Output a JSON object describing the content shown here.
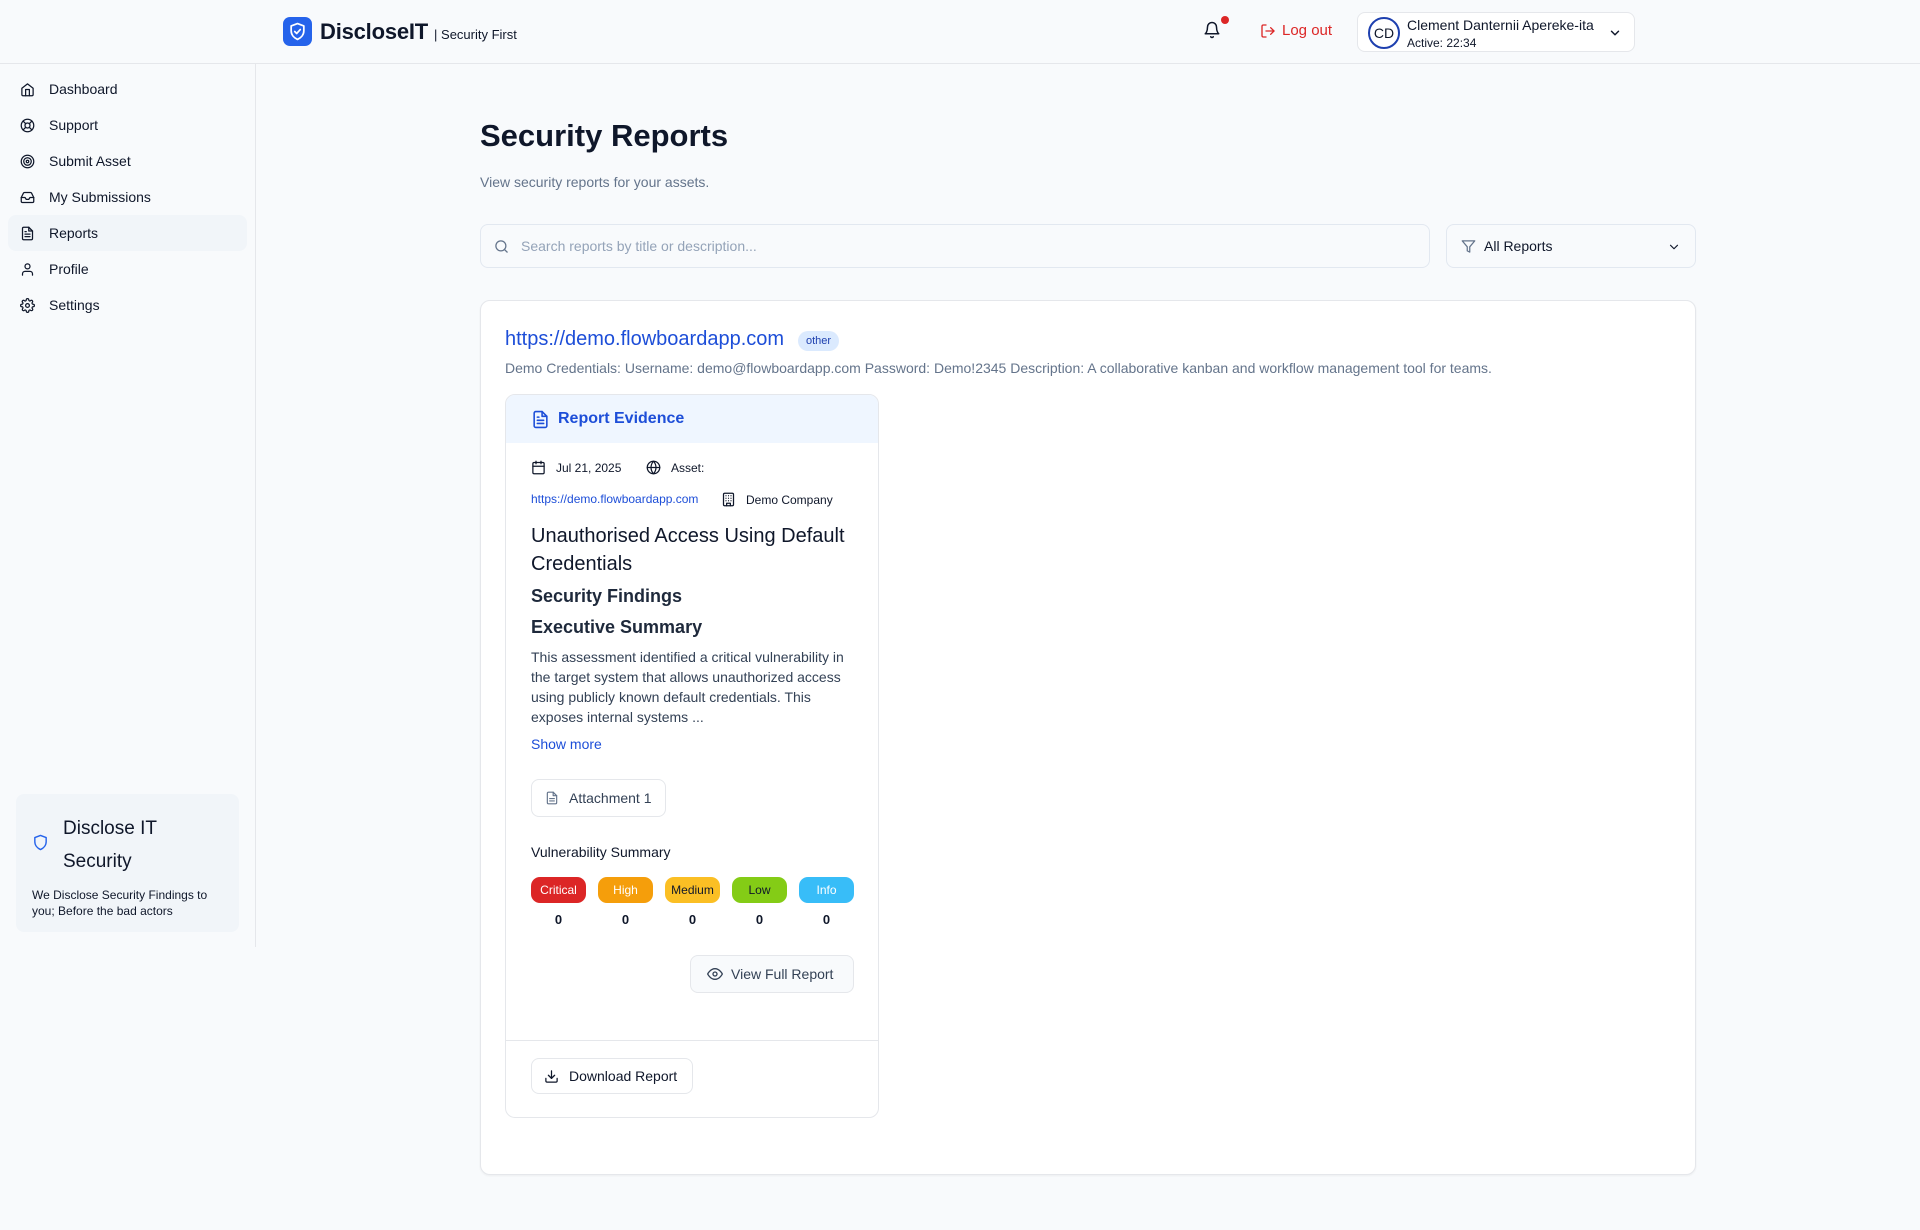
{
  "header": {
    "brand_name": "DiscloseIT",
    "brand_tagline": "| Security First",
    "logout_label": "Log out",
    "user": {
      "initials": "CD",
      "name": "Clement Danternii Apereke-ita",
      "active": "Active: 22:34"
    }
  },
  "sidebar": {
    "items": [
      {
        "label": "Dashboard",
        "icon": "home-icon"
      },
      {
        "label": "Support",
        "icon": "lifebuoy-icon"
      },
      {
        "label": "Submit Asset",
        "icon": "target-icon"
      },
      {
        "label": "My Submissions",
        "icon": "inbox-icon"
      },
      {
        "label": "Reports",
        "icon": "file-text-icon"
      },
      {
        "label": "Profile",
        "icon": "user-icon"
      },
      {
        "label": "Settings",
        "icon": "gear-icon"
      }
    ],
    "active_item": "Reports",
    "promo": {
      "title": "Disclose IT Security",
      "text": "We Disclose Security Findings to you; Before the bad actors"
    }
  },
  "main": {
    "title": "Security Reports",
    "subtitle": "View security reports for your assets.",
    "search_placeholder": "Search reports by title or description...",
    "filter_label": "All Reports",
    "asset": {
      "url": "https://demo.flowboardapp.com",
      "badge": "other",
      "description": "Demo Credentials: Username: demo@flowboardapp.com Password: Demo!2345 Description: A collaborative kanban and workflow management tool for teams.",
      "report": {
        "header": "Report Evidence",
        "date": "Jul 21, 2025",
        "asset_label": "Asset:",
        "asset_link": "https://demo.flowboardapp.com",
        "company": "Demo Company",
        "title": "Unauthorised Access Using Default Credentials",
        "findings_heading": "Security Findings",
        "summary_heading": "Executive Summary",
        "summary_text": "This assessment identified a critical vulnerability in the target system that allows unauthorized access using publicly known default credentials. This exposes internal systems ...",
        "show_more": "Show more",
        "attachment": "Attachment 1",
        "vuln_summary_label": "Vulnerability Summary",
        "severities": [
          {
            "label": "Critical",
            "count": "0",
            "color": "#dc2626",
            "text_color": "#ffffff"
          },
          {
            "label": "High",
            "count": "0",
            "color": "#f59e0b",
            "text_color": "#ffffff"
          },
          {
            "label": "Medium",
            "count": "0",
            "color": "#fbbf24",
            "text_color": "#0f172a"
          },
          {
            "label": "Low",
            "count": "0",
            "color": "#84cc16",
            "text_color": "#0f172a"
          },
          {
            "label": "Info",
            "count": "0",
            "color": "#38bdf8",
            "text_color": "#ffffff"
          }
        ],
        "view_full_label": "View Full Report",
        "download_label": "Download Report"
      }
    }
  },
  "colors": {
    "accent": "#2563eb",
    "link": "#1d4ed8",
    "danger": "#dc2626"
  }
}
